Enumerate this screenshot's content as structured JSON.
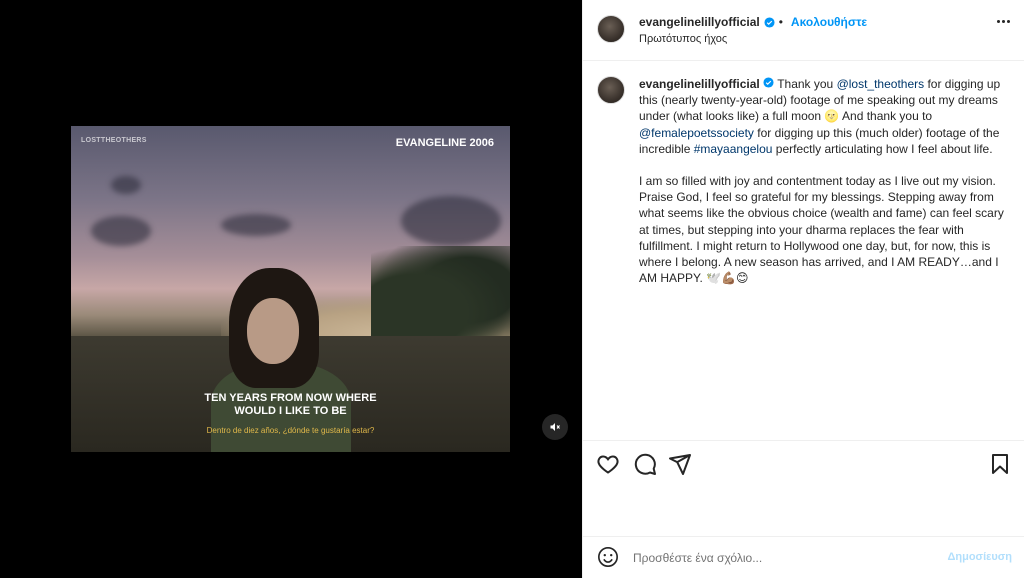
{
  "video": {
    "overlay_handle": "LOSTTHEOTHERS",
    "overlay_title": "EVANGELINE 2006",
    "subtitle_line1": "TEN YEARS FROM NOW WHERE",
    "subtitle_line2": "WOULD I LIKE TO BE",
    "subtitle_spanish": "Dentro de diez años, ¿dónde te gustaría estar?",
    "muted": true
  },
  "header": {
    "username": "evangelinelillyofficial",
    "separator": "•",
    "follow_label": "Ακολουθήστε",
    "audio_label": "Πρωτότυπος ήχος",
    "more_icon": "more-horizontal-icon"
  },
  "caption": {
    "username": "evangelinelillyofficial",
    "p1_part1": "Thank you ",
    "p1_mention1": "@lost_theothers",
    "p1_part2": " for digging up this (nearly twenty-year-old) footage of me speaking out my dreams under (what looks like) a full moon 🌝 And thank you to ",
    "p1_mention2": "@femalepoetssociety",
    "p1_part3": " for digging up this (much older) footage of the incredible ",
    "p1_hashtag": "#mayaangelou",
    "p1_part4": " perfectly articulating how I feel about life.",
    "p2": "I am so filled with joy and contentment today as I live out my vision. Praise God, I feel so grateful for my blessings. Stepping away from what seems like the obvious choice (wealth and fame) can feel scary at times, but stepping into your dharma replaces the fear with fulfillment. I might return to Hollywood one day, but, for now, this is where I belong. A new season has arrived, and I AM READY…and I AM HAPPY. 🕊️💪🏽😊"
  },
  "comment_bar": {
    "placeholder": "Προσθέστε ένα σχόλιο...",
    "post_label": "Δημοσίευση"
  },
  "colors": {
    "accent": "#0095f6",
    "mention": "#00376b",
    "post_disabled": "#b2dffc",
    "subtitle_yellow": "#e0b84a"
  }
}
